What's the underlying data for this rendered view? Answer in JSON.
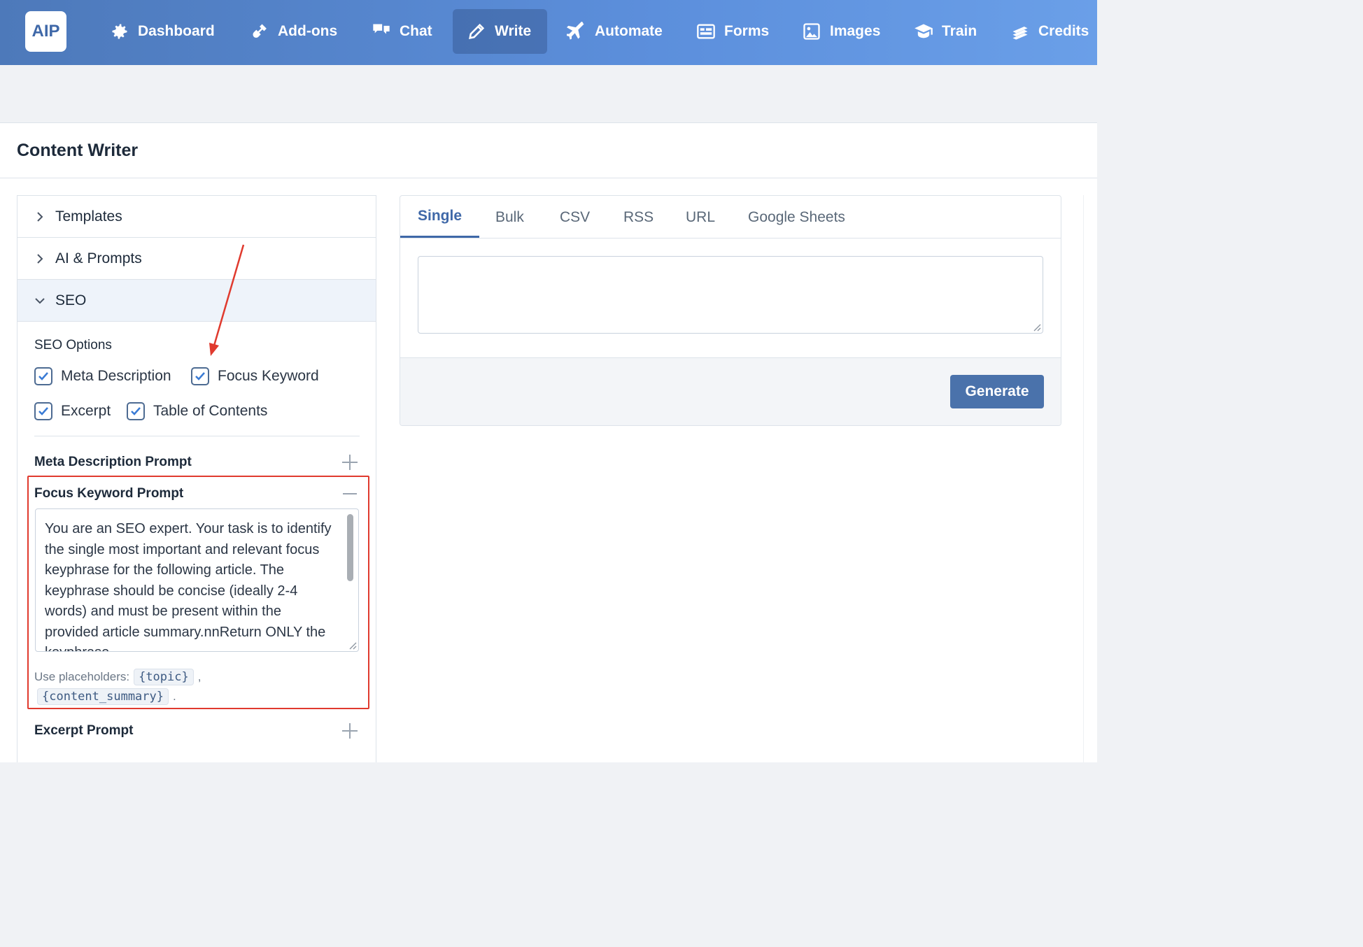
{
  "logo": "AIP",
  "nav": [
    {
      "label": "Dashboard",
      "icon": "gear-icon"
    },
    {
      "label": "Add-ons",
      "icon": "plug-icon"
    },
    {
      "label": "Chat",
      "icon": "chat-bubbles-icon"
    },
    {
      "label": "Write",
      "icon": "pencil-icon",
      "active": true
    },
    {
      "label": "Automate",
      "icon": "plane-icon"
    },
    {
      "label": "Forms",
      "icon": "form-icon"
    },
    {
      "label": "Images",
      "icon": "image-icon"
    },
    {
      "label": "Train",
      "icon": "graduation-cap-icon"
    },
    {
      "label": "Credits",
      "icon": "coins-icon"
    }
  ],
  "page_title": "Content Writer",
  "accordion": {
    "templates": "Templates",
    "ai_prompts": "AI & Prompts",
    "seo": "SEO"
  },
  "seo": {
    "options_label": "SEO Options",
    "options": [
      {
        "label": "Meta Description",
        "checked": true
      },
      {
        "label": "Focus Keyword",
        "checked": true
      },
      {
        "label": "Excerpt",
        "checked": true
      },
      {
        "label": "Table of Contents",
        "checked": true
      }
    ],
    "meta_prompt_label": "Meta Description Prompt",
    "focus_prompt_label": "Focus Keyword Prompt",
    "focus_prompt_text": "You are an SEO expert. Your task is to identify the single most important and relevant focus keyphrase for the following article. The keyphrase should be concise (ideally 2-4 words) and must be present within the provided article summary.nnReturn ONLY the keyphrase",
    "placeholders_label": "Use placeholders:",
    "placeholder_1": "{topic}",
    "placeholder_2": "{content_summary}",
    "comma": ",",
    "period": ".",
    "excerpt_prompt_label": "Excerpt Prompt"
  },
  "tabs": [
    "Single",
    "Bulk",
    "CSV",
    "RSS",
    "URL",
    "Google Sheets"
  ],
  "active_tab": "Single",
  "generate_label": "Generate",
  "colors": {
    "accent": "#3f68a8",
    "annotation": "#e03a2e",
    "button": "#4a72ab"
  }
}
